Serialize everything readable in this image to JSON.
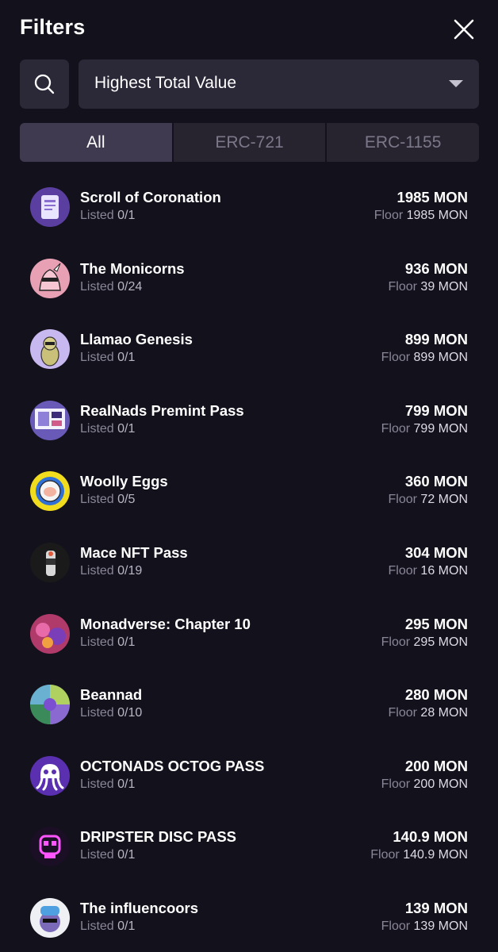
{
  "header": {
    "title": "Filters",
    "close_icon": "close-icon"
  },
  "search": {
    "icon": "search-icon"
  },
  "sort": {
    "value": "Highest Total Value",
    "icon": "caret-down-icon"
  },
  "tabs": [
    {
      "label": "All",
      "active": true
    },
    {
      "label": "ERC-721",
      "active": false
    },
    {
      "label": "ERC-1155",
      "active": false
    }
  ],
  "labels": {
    "listed": "Listed",
    "floor": "Floor"
  },
  "collections": [
    {
      "name": "Scroll of Coronation",
      "listed": "0/1",
      "total": "1985 MON",
      "floor": "1985 MON",
      "avatar_color": "#5b3fa0"
    },
    {
      "name": "The Monicorns",
      "listed": "0/24",
      "total": "936 MON",
      "floor": "39 MON",
      "avatar_color": "#e8a0b4"
    },
    {
      "name": "Llamao Genesis",
      "listed": "0/1",
      "total": "899 MON",
      "floor": "899 MON",
      "avatar_color": "#c8b8f0"
    },
    {
      "name": "RealNads Premint Pass",
      "listed": "0/1",
      "total": "799 MON",
      "floor": "799 MON",
      "avatar_color": "#6a5ab8"
    },
    {
      "name": "Woolly Eggs",
      "listed": "0/5",
      "total": "360 MON",
      "floor": "72 MON",
      "avatar_color": "#f2dc1e"
    },
    {
      "name": "Mace NFT Pass",
      "listed": "0/19",
      "total": "304 MON",
      "floor": "16 MON",
      "avatar_color": "#1a1a1a"
    },
    {
      "name": "Monadverse: Chapter 10",
      "listed": "0/1",
      "total": "295 MON",
      "floor": "295 MON",
      "avatar_color": "#b03a6a"
    },
    {
      "name": "Beannad",
      "listed": "0/10",
      "total": "280 MON",
      "floor": "28 MON",
      "avatar_color": "#5aa06a"
    },
    {
      "name": "OCTONADS OCTOG PASS",
      "listed": "0/1",
      "total": "200 MON",
      "floor": "200 MON",
      "avatar_color": "#5a2fb0"
    },
    {
      "name": "DRIPSTER DISC PASS",
      "listed": "0/1",
      "total": "140.9 MON",
      "floor": "140.9 MON",
      "avatar_color": "#1a0f24"
    },
    {
      "name": "The influencoors",
      "listed": "0/1",
      "total": "139 MON",
      "floor": "139 MON",
      "avatar_color": "#eef0f4"
    }
  ]
}
